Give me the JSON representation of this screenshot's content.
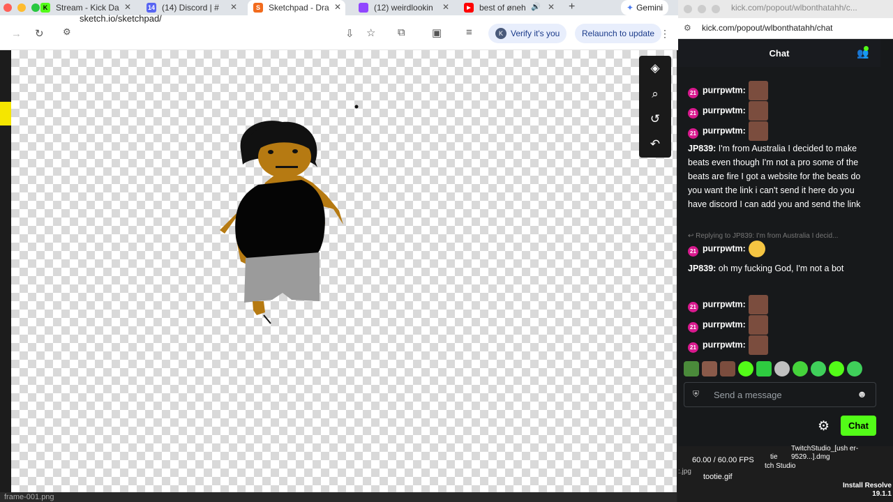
{
  "tabs": [
    {
      "label": "Stream - Kick Da",
      "color": "#53fc18",
      "glyph": "K"
    },
    {
      "label": "(14) Discord | #",
      "color": "#5865f2",
      "glyph": "14"
    },
    {
      "label": "Sketchpad - Dra",
      "color": "#f26b1d",
      "glyph": "S",
      "active": true
    },
    {
      "label": "(12) weirdlookin",
      "color": "#9146ff",
      "glyph": ""
    },
    {
      "label": "best of øneh",
      "color": "#ff0000",
      "glyph": "▶"
    }
  ],
  "gemini_label": "Gemini",
  "url": "sketch.io/sketchpad/",
  "verify_label": "Verify it's you",
  "verify_initial": "K",
  "relaunch_label": "Relaunch to update",
  "popout_title": "kick.com/popout/wlbonthatahh/c...",
  "popout_url": "kick.com/popout/wlbonthatahh/chat",
  "chat_title": "Chat",
  "badge_text": "21",
  "messages": [
    {
      "user": "purrpwtm:",
      "text": ""
    },
    {
      "user": "purrpwtm:",
      "text": ""
    },
    {
      "user": "purrpwtm:",
      "text": ""
    },
    {
      "user": "JP839:",
      "text": "I'm from Australia I decided to make beats even though I'm not a pro some of the beats are fire I got a website for the beats do you want the link i can't send it here do you have discord I can add you and send the link"
    },
    {
      "reply": "Replying to JP839: I'm from Australia I decid..."
    },
    {
      "user": "purrpwtm:",
      "text": ""
    },
    {
      "user": "JP839:",
      "text": "oh my fucking God, I'm not a bot"
    },
    {
      "user": "purrpwtm:",
      "text": ""
    },
    {
      "user": "purrpwtm:",
      "text": ""
    },
    {
      "user": "purrpwtm:",
      "text": ""
    }
  ],
  "input_placeholder": "Send a message",
  "chat_button": "Chat",
  "fps": "60.00 / 60.00 FPS",
  "desktop": {
    "twitch_label": "TwitchStudio_[ush er-9529...].dmg",
    "twitch_studio": "tch Studio",
    "tie": "tie",
    "tootie": "tootie.gif",
    "jpg": ":.jpg",
    "install": "Install Resolve 19.1.1"
  },
  "status_file": "frame-001.png",
  "colors": {
    "kick_green": "#53fc18",
    "badge_pink": "#d8198e"
  }
}
